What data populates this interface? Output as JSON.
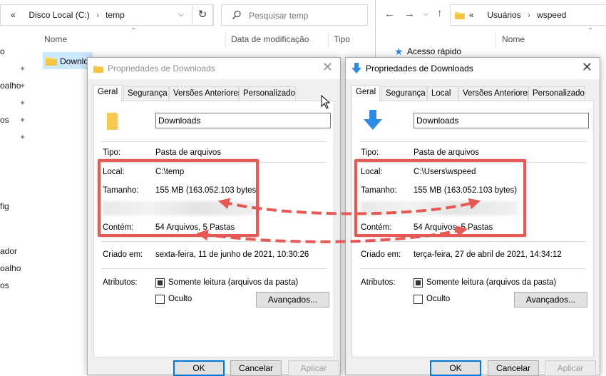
{
  "colors": {
    "accent": "#0078d7",
    "highlight": "#e65a55",
    "folder": "#f8d775"
  },
  "left_explorer": {
    "breadcrumb": {
      "chevrons": "«",
      "parts": [
        "Disco Local (C:)",
        "temp"
      ]
    },
    "search_placeholder": "Pesquisar temp",
    "columns": [
      "Nome",
      "Data de modificação",
      "Tipo"
    ],
    "nav_fragments": [
      "o",
      "oalho",
      "os",
      "fig",
      "ador",
      "oalho",
      "os"
    ],
    "selected_item": "Downlo"
  },
  "right_explorer": {
    "breadcrumb": {
      "chevrons": "«",
      "parts": [
        "Usuários",
        "wspeed"
      ]
    },
    "columns": [
      "Nome"
    ],
    "quick_access": "Acesso rápido"
  },
  "dialog_left": {
    "title": "Propriedades de Downloads",
    "tabs": [
      "Geral",
      "Segurança",
      "Versões Anteriores",
      "Personalizado"
    ],
    "name": "Downloads",
    "props": {
      "tipo_label": "Tipo:",
      "tipo": "Pasta de arquivos",
      "local_label": "Local:",
      "local": "C:\\temp",
      "tamanho_label": "Tamanho:",
      "tamanho": "155 MB (163.052.103 bytes)",
      "conteudo_label": "Contém:",
      "conteudo": "54 Arquivos, 5 Pastas",
      "criado_label": "Criado em:",
      "criado": "sexta-feira, 11 de junho de 2021, 10:30:26",
      "atributos_label": "Atributos:",
      "somente_leitura": "Somente leitura (arquivos da pasta)",
      "oculto": "Oculto",
      "avancados": "Avançados..."
    },
    "buttons": [
      "OK",
      "Cancelar",
      "Aplicar"
    ]
  },
  "dialog_right": {
    "title": "Propriedades de Downloads",
    "tabs": [
      "Geral",
      "Segurança",
      "Local",
      "Versões Anteriores",
      "Personalizado"
    ],
    "name": "Downloads",
    "props": {
      "tipo_label": "Tipo:",
      "tipo": "Pasta de arquivos",
      "local_label": "Local:",
      "local": "C:\\Users\\wspeed",
      "tamanho_label": "Tamanho:",
      "tamanho": "155 MB (163.052.103 bytes)",
      "conteudo_label": "Contém:",
      "conteudo": "54 Arquivos, 5 Pastas",
      "criado_label": "Criado em:",
      "criado": "terça-feira, 27 de abril de 2021, 14:34:12",
      "atributos_label": "Atributos:",
      "somente_leitura": "Somente leitura (arquivos da pasta)",
      "oculto": "Oculto",
      "avancados": "Avançados..."
    },
    "buttons": [
      "OK",
      "Cancelar",
      "Aplicar"
    ]
  }
}
